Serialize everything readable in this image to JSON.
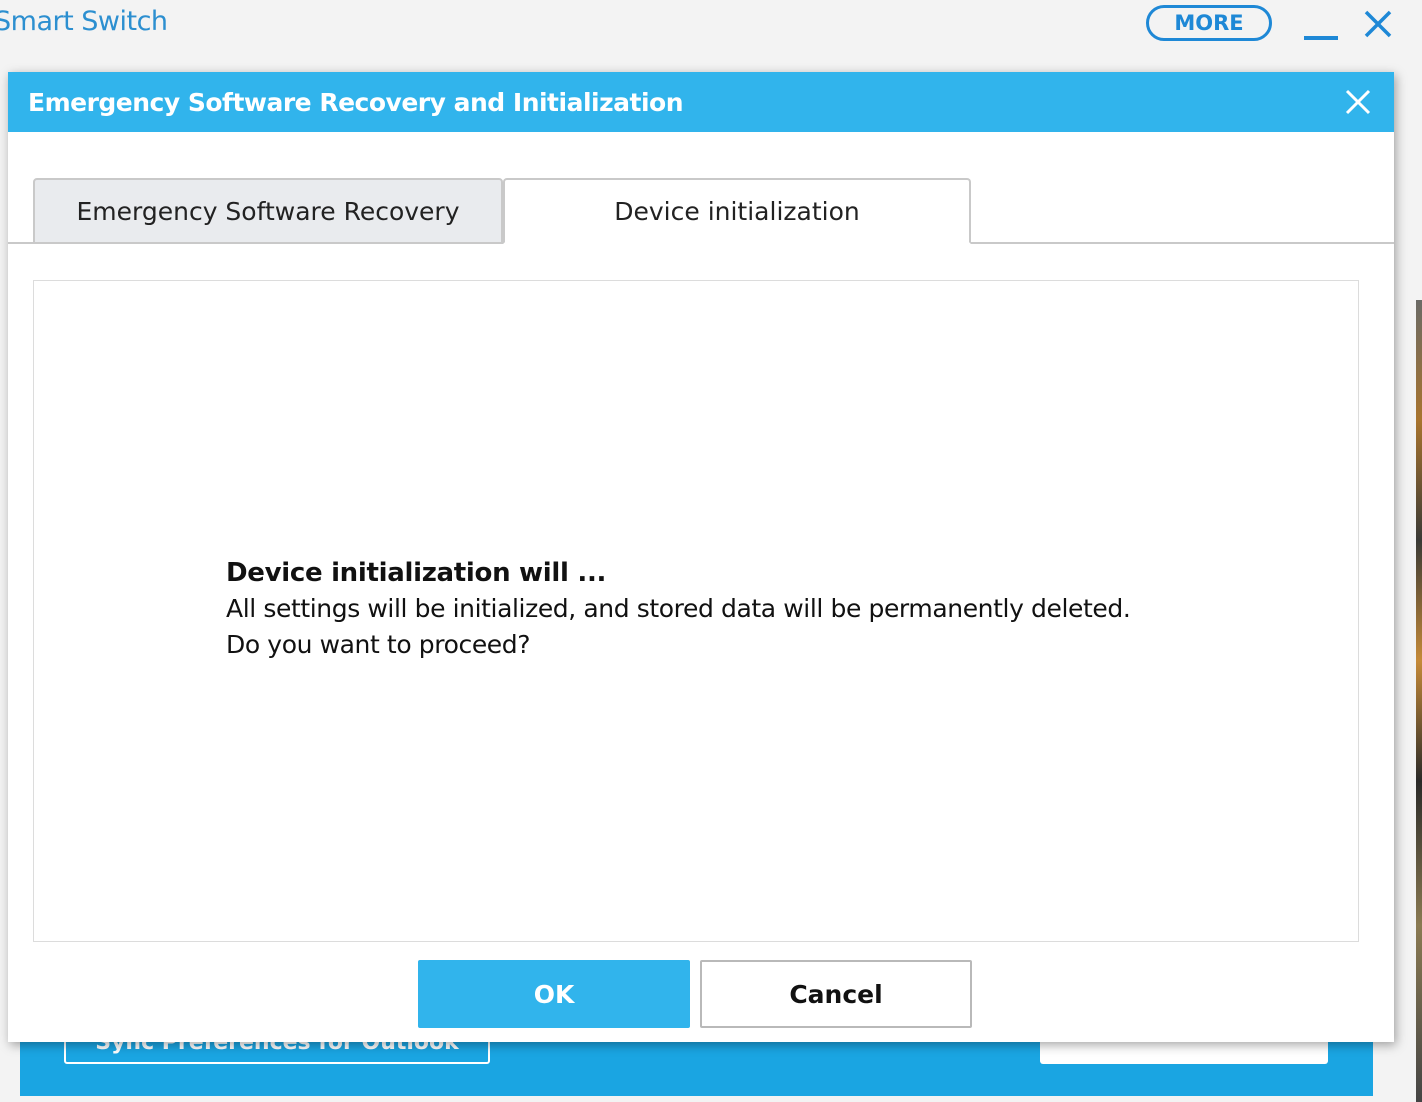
{
  "app": {
    "title": "Smart Switch",
    "more_label": "MORE",
    "minimize_icon": "minimize-icon",
    "close_icon": "close-icon",
    "footer_button_label": "Sync Preferences for Outlook"
  },
  "dialog": {
    "title": "Emergency Software Recovery and Initialization",
    "close_icon": "close-icon",
    "tabs": [
      {
        "label": "Emergency Software Recovery",
        "selected": false
      },
      {
        "label": "Device initialization",
        "selected": true
      }
    ],
    "message": {
      "heading": "Device initialization will ...",
      "line1": "All settings will be initialized, and stored data will be permanently deleted.",
      "line2": "Do you want to proceed?"
    },
    "buttons": {
      "ok_label": "OK",
      "cancel_label": "Cancel"
    }
  },
  "colors": {
    "accent": "#31b4ec",
    "app_blue": "#1e88d6",
    "footer_blue": "#1aa5e2"
  }
}
